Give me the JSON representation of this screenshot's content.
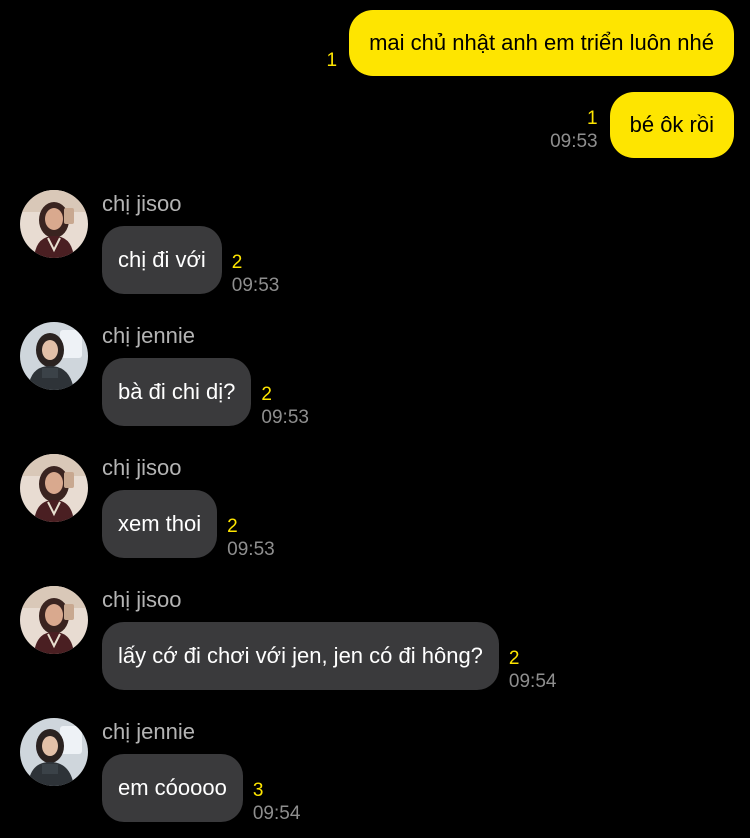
{
  "colors": {
    "background": "#000000",
    "outgoing_bubble": "#FEE500",
    "incoming_bubble": "#3a3a3c",
    "unread_count": "#FEE500",
    "timestamp": "#8e8e8e",
    "sender_name": "#b4b4b4"
  },
  "outgoing": [
    {
      "text": "mai chủ nhật anh em triển luôn nhé",
      "unread": "1",
      "time": ""
    },
    {
      "text": "bé ôk rồi",
      "unread": "1",
      "time": "09:53"
    }
  ],
  "incoming": [
    {
      "sender": "chị jisoo",
      "avatar": "jisoo-avatar",
      "text": "chị đi với",
      "unread": "2",
      "time": "09:53"
    },
    {
      "sender": "chị jennie",
      "avatar": "jennie-avatar",
      "text": "bà đi chi dị?",
      "unread": "2",
      "time": "09:53"
    },
    {
      "sender": "chị jisoo",
      "avatar": "jisoo-avatar",
      "text": "xem thoi",
      "unread": "2",
      "time": "09:53"
    },
    {
      "sender": "chị jisoo",
      "avatar": "jisoo-avatar",
      "text": "lấy cớ đi chơi với jen, jen có đi hông?",
      "unread": "2",
      "time": "09:54"
    },
    {
      "sender": "chị jennie",
      "avatar": "jennie-avatar",
      "text": "em cóoooo",
      "unread": "3",
      "time": "09:54"
    }
  ]
}
